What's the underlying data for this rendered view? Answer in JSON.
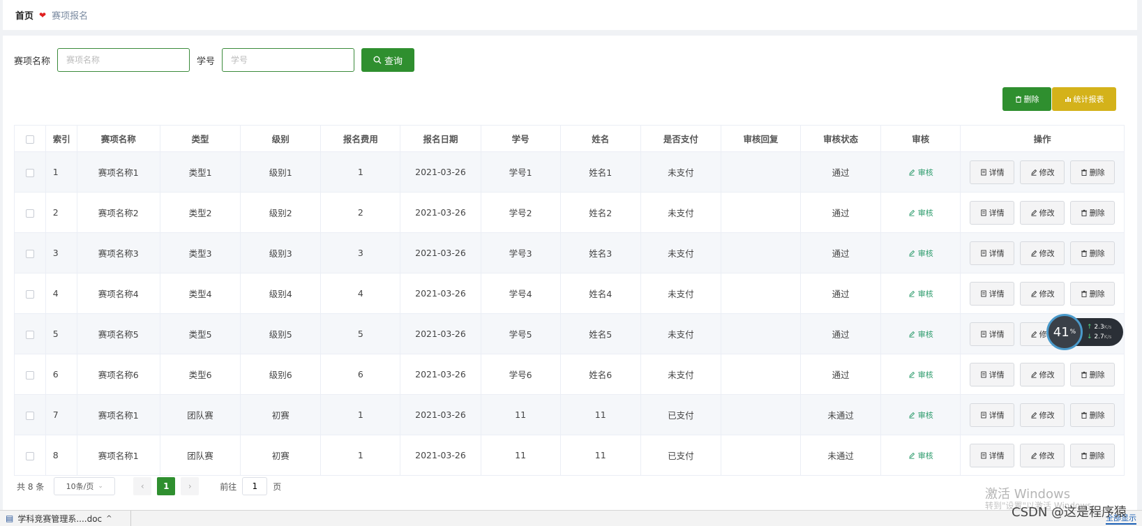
{
  "breadcrumb": {
    "home": "首页",
    "current": "赛项报名"
  },
  "search": {
    "name_label": "赛项名称",
    "name_placeholder": "赛项名称",
    "id_label": "学号",
    "id_placeholder": "学号",
    "query_label": "查询"
  },
  "toolbar": {
    "delete_label": "删除",
    "report_label": "统计报表"
  },
  "table": {
    "headers": [
      "索引",
      "赛项名称",
      "类型",
      "级别",
      "报名费用",
      "报名日期",
      "学号",
      "姓名",
      "是否支付",
      "审核回复",
      "审核状态",
      "审核",
      "操作"
    ],
    "rows": [
      {
        "idx": "1",
        "name": "赛项名称1",
        "type": "类型1",
        "level": "级别1",
        "fee": "1",
        "date": "2021-03-26",
        "sid": "学号1",
        "sname": "姓名1",
        "paid": "未支付",
        "reply": "",
        "status": "通过"
      },
      {
        "idx": "2",
        "name": "赛项名称2",
        "type": "类型2",
        "level": "级别2",
        "fee": "2",
        "date": "2021-03-26",
        "sid": "学号2",
        "sname": "姓名2",
        "paid": "未支付",
        "reply": "",
        "status": "通过"
      },
      {
        "idx": "3",
        "name": "赛项名称3",
        "type": "类型3",
        "level": "级别3",
        "fee": "3",
        "date": "2021-03-26",
        "sid": "学号3",
        "sname": "姓名3",
        "paid": "未支付",
        "reply": "",
        "status": "通过"
      },
      {
        "idx": "4",
        "name": "赛项名称4",
        "type": "类型4",
        "level": "级别4",
        "fee": "4",
        "date": "2021-03-26",
        "sid": "学号4",
        "sname": "姓名4",
        "paid": "未支付",
        "reply": "",
        "status": "通过"
      },
      {
        "idx": "5",
        "name": "赛项名称5",
        "type": "类型5",
        "level": "级别5",
        "fee": "5",
        "date": "2021-03-26",
        "sid": "学号5",
        "sname": "姓名5",
        "paid": "未支付",
        "reply": "",
        "status": "通过"
      },
      {
        "idx": "6",
        "name": "赛项名称6",
        "type": "类型6",
        "level": "级别6",
        "fee": "6",
        "date": "2021-03-26",
        "sid": "学号6",
        "sname": "姓名6",
        "paid": "未支付",
        "reply": "",
        "status": "通过"
      },
      {
        "idx": "7",
        "name": "赛项名称1",
        "type": "团队赛",
        "level": "初赛",
        "fee": "1",
        "date": "2021-03-26",
        "sid": "11",
        "sname": "11",
        "paid": "已支付",
        "reply": "",
        "status": "未通过"
      },
      {
        "idx": "8",
        "name": "赛项名称1",
        "type": "团队赛",
        "level": "初赛",
        "fee": "1",
        "date": "2021-03-26",
        "sid": "11",
        "sname": "11",
        "paid": "已支付",
        "reply": "",
        "status": "未通过"
      }
    ],
    "audit_label": "审核",
    "detail_label": "详情",
    "edit_label": "修改",
    "delete_label": "删除"
  },
  "pager": {
    "total": "共 8 条",
    "page_size": "10条/页",
    "current_page": "1",
    "goto_prefix": "前往",
    "goto_value": "1",
    "goto_suffix": "页"
  },
  "overlay": {
    "cpu": "41",
    "cpu_unit": "%",
    "up_rate": "2.3",
    "down_rate": "2.7",
    "rate_unit": "K/s",
    "watermark_title": "激活 Windows",
    "watermark_sub": "转到\"设置\"以激活 Windows。",
    "csdn": "CSDN @这是程序猿"
  },
  "taskbar": {
    "doc_name": "学科竞赛管理系....doc",
    "show_all": "全部显示"
  },
  "colors": {
    "primary": "#2f8f2f",
    "warning": "#d4b21a",
    "link": "#2a9a6a"
  }
}
